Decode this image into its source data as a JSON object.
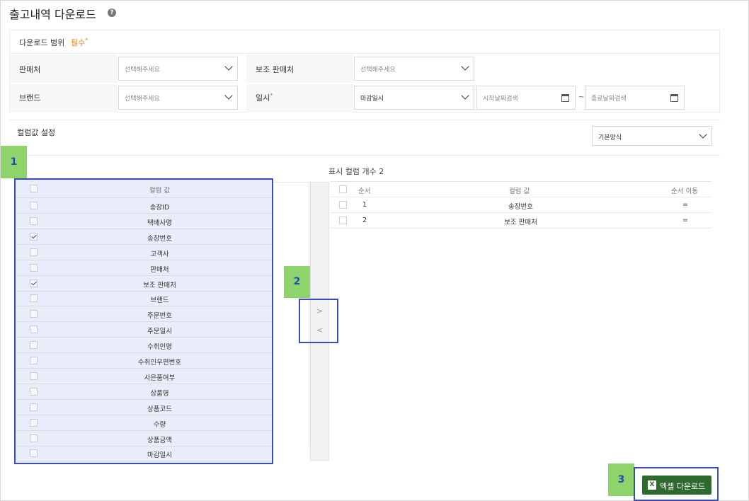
{
  "header": {
    "title": "출고내역 다운로드",
    "help_glyph": "?"
  },
  "range": {
    "title": "다운로드 범위",
    "required_label": "필수",
    "required_mark": "*",
    "fields": {
      "seller_label": "판매처",
      "seller_value": "선택해주세요",
      "sub_seller_label": "보조 판매처",
      "sub_seller_value": "선택해주세요",
      "brand_label": "브랜드",
      "brand_value": "선택해주세요",
      "date_label": "일시",
      "date_type_value": "마감일시",
      "start_date_placeholder": "시작날짜검색",
      "end_date_placeholder": "종료날짜검색",
      "range_separator": "~"
    }
  },
  "columns": {
    "title": "컬럼값 설정",
    "preset_value": "기본양식",
    "counter_label": "표시 컬럼 개수 2",
    "left_header": "컬럼 값",
    "available": [
      {
        "name": "송장ID",
        "checked": false
      },
      {
        "name": "택배사명",
        "checked": false
      },
      {
        "name": "송장번호",
        "checked": true
      },
      {
        "name": "고객사",
        "checked": false
      },
      {
        "name": "판매처",
        "checked": false
      },
      {
        "name": "보조 판매처",
        "checked": true
      },
      {
        "name": "브랜드",
        "checked": false
      },
      {
        "name": "주문번호",
        "checked": false
      },
      {
        "name": "주문일시",
        "checked": false
      },
      {
        "name": "수취인명",
        "checked": false
      },
      {
        "name": "수취인우편번호",
        "checked": false
      },
      {
        "name": "사은품여부",
        "checked": false
      },
      {
        "name": "상품명",
        "checked": false
      },
      {
        "name": "상품코드",
        "checked": false
      },
      {
        "name": "수량",
        "checked": false
      },
      {
        "name": "상품금액",
        "checked": false
      },
      {
        "name": "마감일시",
        "checked": false
      }
    ],
    "move_right": ">",
    "move_left": "<",
    "right_headers": {
      "order": "순서",
      "value": "컬럼 값",
      "move": "순서 이동"
    },
    "selected": [
      {
        "order": "1",
        "name": "송장번호",
        "handle": "="
      },
      {
        "order": "2",
        "name": "보조 판매처",
        "handle": "="
      }
    ]
  },
  "badges": {
    "b1": "1",
    "b2": "2",
    "b3": "3"
  },
  "excel": {
    "icon_glyph": "X",
    "label": "엑셀 다운로드"
  },
  "colors": {
    "accent_blue": "#3c4db8",
    "badge_green": "#8fd46a",
    "excel_green": "#2e6a2e",
    "required_orange": "#e2801c"
  }
}
